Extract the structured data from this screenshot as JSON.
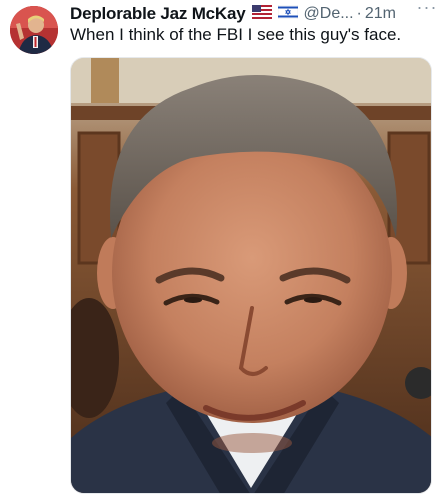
{
  "tweet": {
    "author": {
      "display_name": "Deplorable Jaz McKay",
      "handle_truncated": "@De...",
      "badges": [
        "us-flag-icon",
        "israel-flag-icon"
      ]
    },
    "dot": "·",
    "time": "21m",
    "more_label": "···",
    "text": "When I think of the FBI I see this guy's face.",
    "media": {
      "type": "photo",
      "subject": "close-up face photo of a man in a suit"
    }
  },
  "colors": {
    "text_primary": "#0f1419",
    "text_secondary": "#536471",
    "background": "#ffffff"
  }
}
